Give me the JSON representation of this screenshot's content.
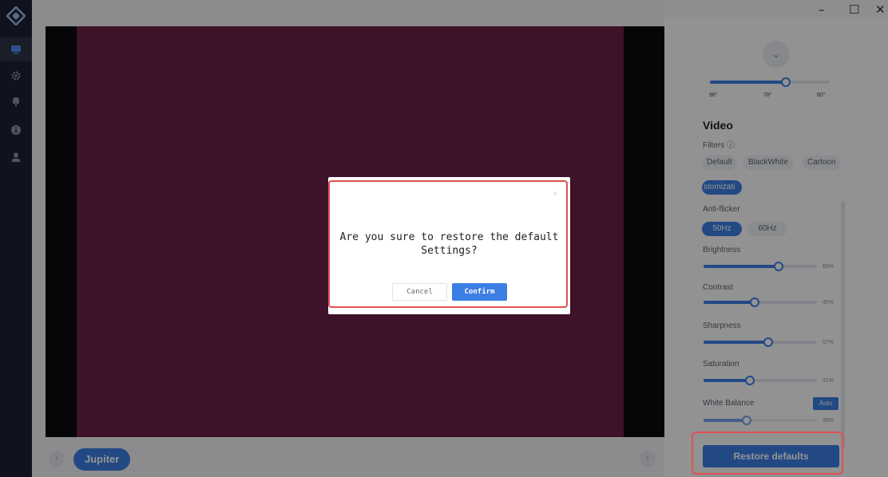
{
  "window": {
    "minimize_glyph": "–",
    "maximize_glyph": "☐",
    "close_glyph": "✕"
  },
  "sidebar": {
    "logo": "diamond-logo-icon",
    "items": [
      {
        "icon": "monitor-icon",
        "active": true
      },
      {
        "icon": "gear-icon",
        "active": false
      },
      {
        "icon": "bell-icon",
        "active": false
      },
      {
        "icon": "info-icon",
        "active": false
      },
      {
        "icon": "user-icon",
        "active": false
      }
    ]
  },
  "main": {
    "prev_glyph": "‹",
    "next_glyph": "›",
    "device_name": "Jupiter"
  },
  "panel": {
    "chevron_glyph": "⌄",
    "fov": {
      "ticks": [
        "96°",
        "78°",
        "60°"
      ],
      "value_fraction": 0.63
    },
    "video_title": "Video",
    "filters": {
      "label": "Filters",
      "info_glyph": "ⓘ",
      "options": [
        "Default",
        "BlackWhite",
        "Cartoon",
        "stomizati"
      ],
      "selected": "stomizati"
    },
    "anti_flicker": {
      "label": "Anti-flicker",
      "options": [
        "50Hz",
        "60Hz"
      ],
      "selected": "50Hz"
    },
    "brightness": {
      "label": "Brightness",
      "value": "66%",
      "level": 0.66
    },
    "contrast": {
      "label": "Contrast",
      "value": "45%",
      "level": 0.45
    },
    "sharpness": {
      "label": "Sharpness",
      "value": "57%",
      "level": 0.57
    },
    "saturation": {
      "label": "Saturation",
      "value": "41%",
      "level": 0.41
    },
    "white_balance": {
      "label": "White Balance",
      "auto_label": "Auto",
      "value": "38%",
      "level": 0.38
    },
    "restore_label": "Restore defaults"
  },
  "dialog": {
    "close_glyph": "×",
    "message": "Are you sure to restore the default Settings?",
    "cancel_label": "Cancel",
    "confirm_label": "Confirm"
  },
  "colors": {
    "accent": "#3c7ee4",
    "highlight": "#e25050",
    "rail": "#1d2233",
    "video": "#6c2046"
  }
}
